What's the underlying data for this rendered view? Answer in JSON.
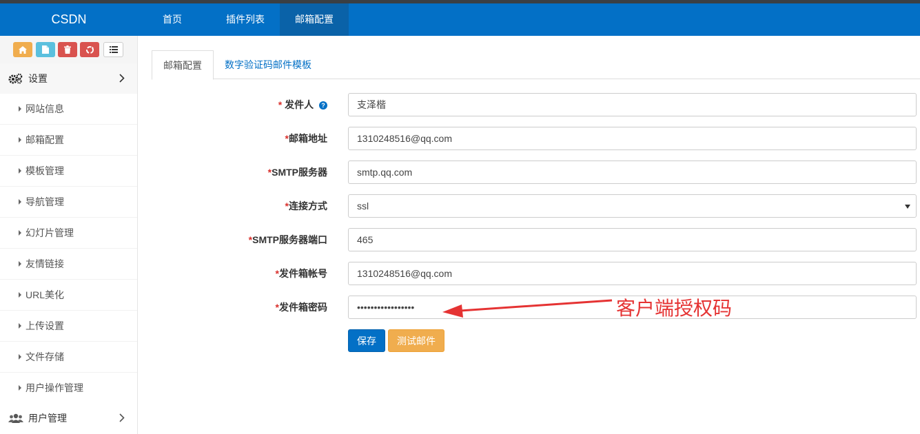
{
  "navbar": {
    "brand": "CSDN",
    "items": [
      {
        "label": "首页"
      },
      {
        "label": "插件列表"
      },
      {
        "label": "邮箱配置"
      }
    ]
  },
  "sidebar": {
    "quick_buttons": [
      {
        "icon": "home-icon",
        "color": "#f0ad4e"
      },
      {
        "icon": "file-icon",
        "color": "#5bc0de"
      },
      {
        "icon": "trash-icon",
        "color": "#d9534f"
      },
      {
        "icon": "recycle-icon",
        "color": "#d9534f"
      },
      {
        "icon": "list-icon",
        "color": "#ffffff"
      }
    ],
    "settings_label": "设置",
    "items": [
      {
        "label": "网站信息"
      },
      {
        "label": "邮箱配置"
      },
      {
        "label": "模板管理"
      },
      {
        "label": "导航管理"
      },
      {
        "label": "幻灯片管理"
      },
      {
        "label": "友情链接"
      },
      {
        "label": "URL美化"
      },
      {
        "label": "上传设置"
      },
      {
        "label": "文件存储"
      },
      {
        "label": "用户操作管理"
      }
    ],
    "users_label": "用户管理"
  },
  "tabs": [
    {
      "label": "邮箱配置"
    },
    {
      "label": "数字验证码邮件模板"
    }
  ],
  "form": {
    "fields": [
      {
        "label": "发件人",
        "value": "支泽楷"
      },
      {
        "label": "邮箱地址",
        "value": "1310248516@qq.com"
      },
      {
        "label": "SMTP服务器",
        "value": "smtp.qq.com"
      },
      {
        "label": "连接方式",
        "value": "ssl"
      },
      {
        "label": "SMTP服务器端口",
        "value": "465"
      },
      {
        "label": "发件箱帐号",
        "value": "1310248516@qq.com"
      },
      {
        "label": "发件箱密码",
        "value": "•••••••••••••••••"
      }
    ],
    "save_label": "保存",
    "test_label": "测试邮件"
  },
  "annotation": {
    "text": "客户端授权码",
    "color": "#e53333"
  },
  "colors": {
    "primary": "#0370c6",
    "warning": "#f0ad4e",
    "danger": "#d9534f",
    "info": "#5bc0de"
  }
}
